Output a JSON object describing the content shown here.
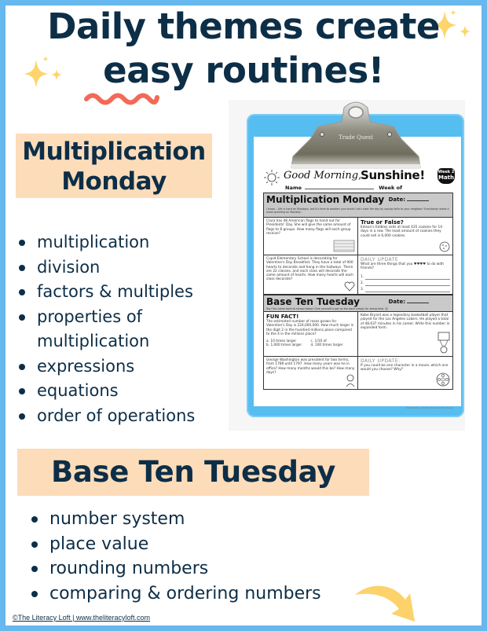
{
  "title": {
    "line1": "Daily themes create",
    "line2_emphasis": "easy",
    "line2_rest": " routines!"
  },
  "colors": {
    "border": "#66b8ee",
    "text": "#0d2e47",
    "label_bg": "#fddcba",
    "squiggle": "#f26a57",
    "sparkle": "#fdd56a",
    "clipboard": "#56bdf0"
  },
  "sections": [
    {
      "label": "Multiplication Monday",
      "label_line1": "Multiplication",
      "label_line2": "Monday",
      "items": [
        "multiplication",
        "division",
        "factors & multiples",
        "properties of",
        "multiplication",
        "expressions",
        "equations",
        "order of operations"
      ]
    },
    {
      "label": "Base Ten Tuesday",
      "items": [
        "number system",
        "place value",
        "rounding numbers",
        "comparing & ordering numbers"
      ]
    }
  ],
  "worksheet": {
    "clip_brand": "Trade Quest",
    "greeting": "Good Morning,",
    "greeting_bold": "Sunshine!",
    "badge_week": "Week 2",
    "badge_subject": "Math",
    "name_label": "Name",
    "week_label": "Week of",
    "date_label": "Date:",
    "monday": {
      "title": "Multiplication Monday",
      "note": "I know... Life is hard on Mondays, but it's time to awaken your brain! Let's start the day by saying hello to your neighbor! Everybody needs a warm greeting on Monday!",
      "cells": [
        {
          "text": "Clara has 48 American flags to hand out for Presidents' Day. She will give the same amount of flags to 8 groups. How many flags will each group receive?"
        },
        {
          "heading": "True or False?",
          "text": "Edison's Edibles sells at least 435 cookies for 14 days in a row. The least amount of cookies they could sell is 6,000 cookies."
        },
        {
          "text": "Cupid Elementary School is decorating for Valentine's Day Breakfast. They have a total of 900 hearts to decorate and hang in the hallways. There are 22 classes, and each class will decorate the same amount of hearts. How many hearts will each class decorate?"
        },
        {
          "heading": "DAILY UPDATE",
          "text": "What are three things that you ♥♥♥♥ to do with friends?",
          "answers": [
            "1.",
            "2.",
            "3."
          ]
        }
      ]
    },
    "tuesday": {
      "title": "Base Ten Tuesday",
      "note": "Yay! You came back to school today! Give yourself a pat on the back simply for being here. ☺",
      "cells": [
        {
          "heading": "FUN FACT!",
          "text": "The estimated number of roses grown for Valentine's Day is 224,000,000. How much larger is the digit 2 in the hundred millions place compared to the 4 in the millions place?",
          "options": [
            "a. 10 times larger",
            "c. 1/10 of",
            "b. 1,000 times larger",
            "d. 100 times larger"
          ]
        },
        {
          "text": "Kobe Bryant was a legendary basketball player that played for the Los Angeles Lakers. He played a total of 48,637 minutes in his career. Write this number in expanded form."
        },
        {
          "text": "George Washington was president for two terms, from 1789 until 1797. How many years was he in office? How many months would this be? How many days?"
        },
        {
          "heading": "DAILY UPDATE:",
          "text": "If you could be one character in a movie, which one would you choose? Why?"
        }
      ]
    },
    "footer": "©The Literacy Loft 2019   4th Grade Daily Review"
  },
  "footer": "©The Literacy Loft | www.theliteracyloft.com"
}
